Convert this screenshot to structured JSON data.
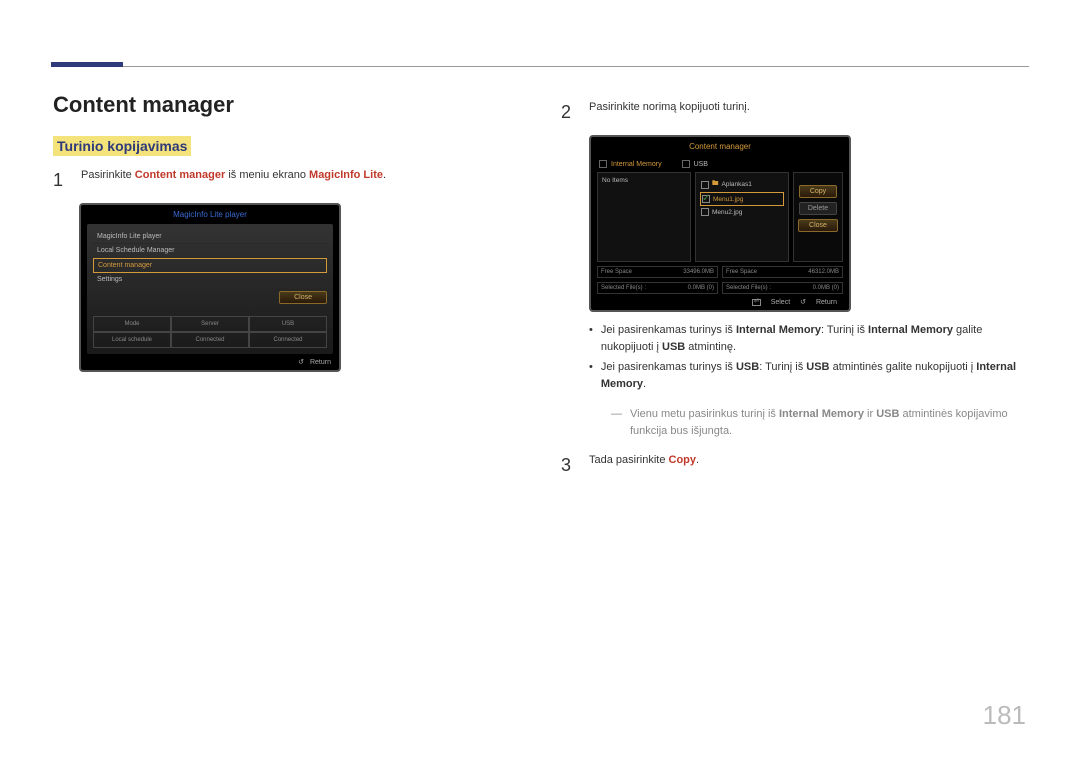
{
  "page_number": "181",
  "heading": "Content manager",
  "subheading": "Turinio kopijavimas",
  "step1": {
    "num": "1",
    "pre": "Pasirinkite ",
    "bold1": "Content manager",
    "mid": " iš meniu ekrano ",
    "bold2": "MagicInfo Lite",
    "post": "."
  },
  "screenshot1": {
    "title": "MagicInfo Lite player",
    "items": [
      "MagicInfo Lite player",
      "Local Schedule Manager",
      "Content manager",
      "Settings"
    ],
    "close": "Close",
    "status_cols": [
      "Mode",
      "Server",
      "USB",
      "Local schedule",
      "Connected",
      "Connected"
    ],
    "return": "Return"
  },
  "step2": {
    "num": "2",
    "text": "Pasirinkite norimą kopijuoti turinį."
  },
  "screenshot2": {
    "title": "Content manager",
    "tab1": "Internal Memory",
    "tab2": "USB",
    "left_empty": "No Items",
    "files": [
      "Aplankas1",
      "Menu1.jpg",
      "Menu2.jpg"
    ],
    "btn_copy": "Copy",
    "btn_delete": "Delete",
    "btn_close": "Close",
    "info": {
      "free1_l": "Free Space",
      "free1_r": "33496.0MB",
      "free2_l": "Free Space",
      "free2_r": "46312.0MB",
      "sel1_l": "Selected File(s) :",
      "sel1_r": "0.0MB (0)",
      "sel2_l": "Selected File(s) :",
      "sel2_r": "0.0MB (0)"
    },
    "footer_select": "Select",
    "footer_return": "Return"
  },
  "bullets": {
    "b1_pre": "Jei pasirenkamas turinys iš ",
    "b1_im": "Internal Memory",
    "b1_mid": ": Turinį iš ",
    "b1_im2": "Internal Memory",
    "b1_mid2": " galite nukopijuoti į ",
    "b1_usb": "USB",
    "b1_post": " atmintinę.",
    "b2_pre": "Jei pasirenkamas turinys iš ",
    "b2_usb": "USB",
    "b2_mid": ": Turinį iš ",
    "b2_usb2": "USB",
    "b2_mid2": " atmintinės galite nukopijuoti į ",
    "b2_im": "Internal Memory",
    "b2_post": "."
  },
  "note": {
    "pre": "Vienu metu pasirinkus turinį iš ",
    "b1": "Internal Memory",
    "mid": " ir ",
    "b2": "USB",
    "post": " atmintinės kopijavimo funkcija bus išjungta."
  },
  "step3": {
    "num": "3",
    "pre": "Tada pasirinkite ",
    "copy": "Copy",
    "post": "."
  }
}
